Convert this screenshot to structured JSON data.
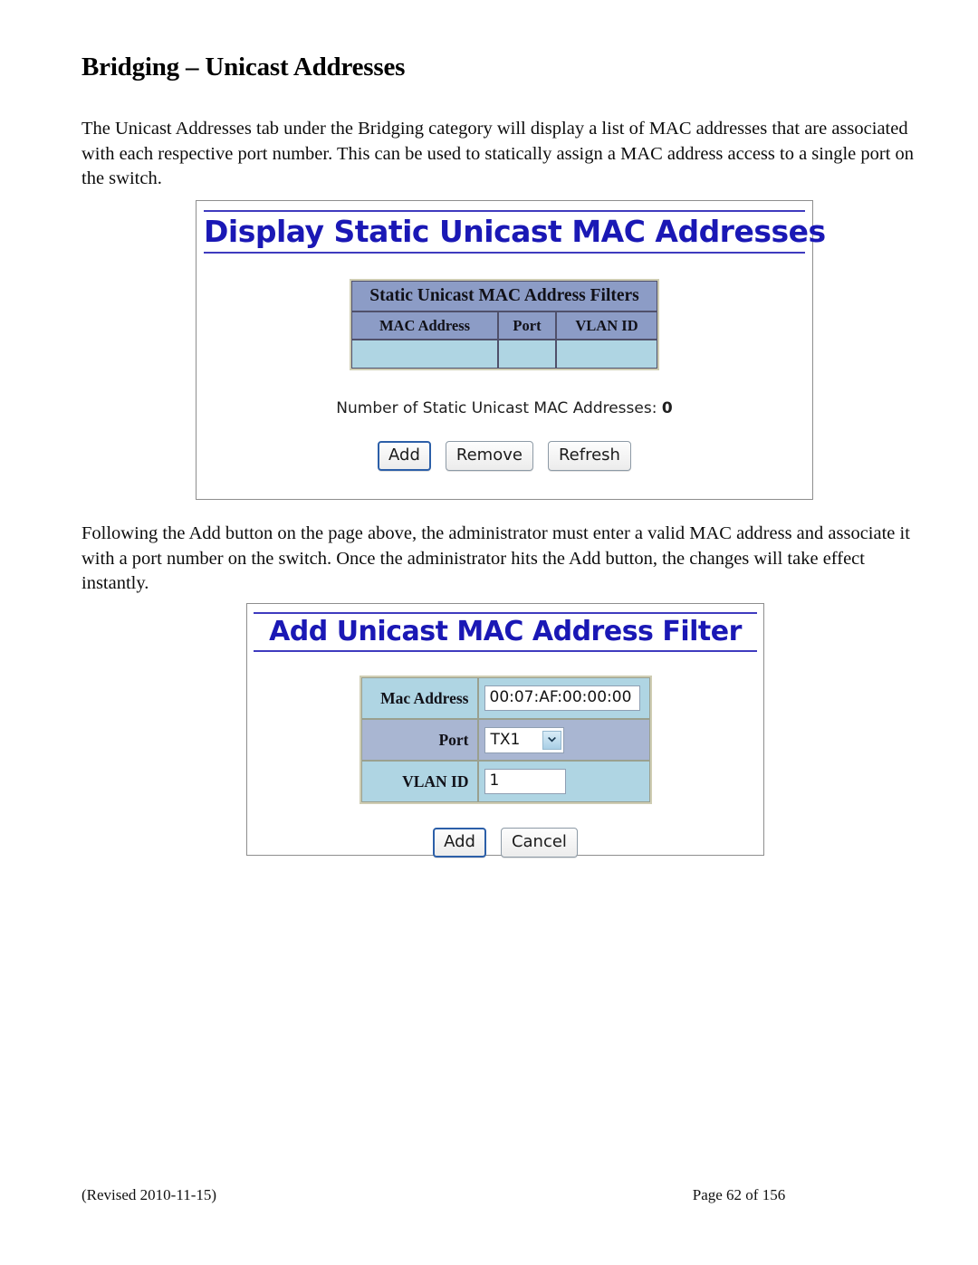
{
  "document": {
    "heading": "Bridging – Unicast Addresses",
    "paragraph_1": "The Unicast Addresses tab under the Bridging category will display a list of MAC addresses that are associated with each respective port number.  This can be used to statically assign a MAC address access to a single port on the switch.",
    "paragraph_2": "Following the Add button on the page above, the administrator must enter a valid MAC address and associate it with a port number on the switch.  Once the administrator hits the Add button, the changes will take effect instantly."
  },
  "screenshot_display": {
    "title": "Display Static Unicast MAC Addresses",
    "table": {
      "span_header": "Static Unicast MAC Address Filters",
      "columns": [
        "MAC Address",
        "Port",
        "VLAN ID"
      ],
      "rows": [
        [
          "",
          "",
          ""
        ]
      ]
    },
    "count_label": "Number of Static Unicast MAC Addresses:",
    "count_value": "0",
    "buttons": [
      {
        "label": "Add",
        "focused": true
      },
      {
        "label": "Remove",
        "focused": false
      },
      {
        "label": "Refresh",
        "focused": false
      }
    ]
  },
  "screenshot_add": {
    "title": "Add Unicast MAC Address Filter",
    "fields": [
      {
        "label": "Mac Address",
        "value": "00:07:AF:00:00:00",
        "type": "text"
      },
      {
        "label": "Port",
        "value": "TX1",
        "type": "select"
      },
      {
        "label": "VLAN ID",
        "value": "1",
        "type": "text"
      }
    ],
    "buttons": [
      {
        "label": "Add",
        "focused": true
      },
      {
        "label": "Cancel",
        "focused": false
      }
    ]
  },
  "footer": {
    "revision": "(Revised 2010-11-15)",
    "page": "Page 62 of 156"
  },
  "colors": {
    "title_blue": "#1a18b5",
    "table_header_blue": "#8c9cc6",
    "table_cell_cyan": "#afd5e3",
    "form_row_blue": "#a9b6d2",
    "table_outer_tan": "#cfcdb3"
  }
}
